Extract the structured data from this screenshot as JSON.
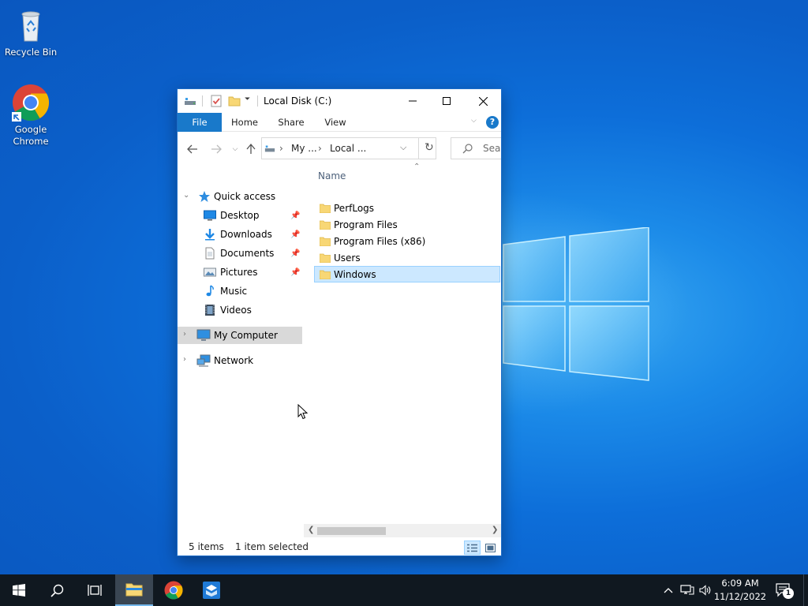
{
  "desktop": {
    "icons": [
      {
        "label": "Recycle Bin",
        "icon": "recycle-bin-icon"
      },
      {
        "label": "Google Chrome",
        "icon": "chrome-icon"
      }
    ]
  },
  "window": {
    "title": "Local Disk (C:)",
    "ribbon_tabs": [
      "File",
      "Home",
      "Share",
      "View"
    ],
    "address_crumbs": [
      "My ...",
      "Local ..."
    ],
    "search_placeholder": "Sear",
    "column_header": "Name",
    "nav_pane": [
      {
        "label": "Quick access",
        "icon": "star-icon"
      },
      {
        "label": "Desktop",
        "icon": "desktop-icon",
        "pinned": true
      },
      {
        "label": "Downloads",
        "icon": "downloads-icon",
        "pinned": true
      },
      {
        "label": "Documents",
        "icon": "documents-icon",
        "pinned": true
      },
      {
        "label": "Pictures",
        "icon": "pictures-icon",
        "pinned": true
      },
      {
        "label": "Music",
        "icon": "music-icon"
      },
      {
        "label": "Videos",
        "icon": "videos-icon"
      },
      {
        "label": "My Computer",
        "icon": "computer-icon",
        "selected": true
      },
      {
        "label": "Network",
        "icon": "network-icon"
      }
    ],
    "files": [
      {
        "name": "PerfLogs"
      },
      {
        "name": "Program Files"
      },
      {
        "name": "Program Files (x86)"
      },
      {
        "name": "Users"
      },
      {
        "name": "Windows",
        "selected": true
      }
    ],
    "status": {
      "items": "5 items",
      "selected": "1 item selected"
    }
  },
  "taskbar": {
    "time": "6:09 AM",
    "date": "11/12/2022",
    "notification_count": "1"
  },
  "colors": {
    "accent": "#1979ca",
    "selection": "#cce8ff",
    "folder": "#f8d775",
    "taskbar": "#101820"
  }
}
